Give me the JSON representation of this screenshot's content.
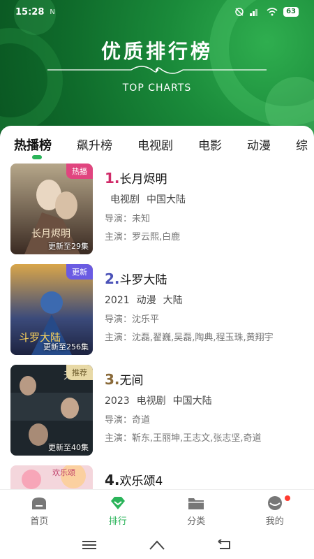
{
  "status": {
    "time": "15:28",
    "battery": "63",
    "nfc": "N"
  },
  "hero": {
    "title": "优质排行榜",
    "subtitle": "TOP CHARTS"
  },
  "tabs": [
    "热播榜",
    "飙升榜",
    "电视剧",
    "电影",
    "动漫",
    "综"
  ],
  "items": [
    {
      "rank": "1.",
      "rank_color": "#d02a68",
      "title": "长月烬明",
      "meta": [
        "电视剧",
        "中国大陆"
      ],
      "year": "",
      "director_label": "导演：",
      "director": "未知",
      "cast_label": "主演：",
      "cast": "罗云熙,白鹿",
      "badge": "热播",
      "badge_color": "#e0457f",
      "update": "更新至29集"
    },
    {
      "rank": "2.",
      "rank_color": "#4b52b8",
      "title": "斗罗大陆",
      "meta": [
        "动漫",
        "大陆"
      ],
      "year": "2021",
      "director_label": "导演：",
      "director": "沈乐平",
      "cast_label": "主演：",
      "cast": "沈磊,翟巍,吴磊,陶典,程玉珠,黄翔宇",
      "badge": "更新",
      "badge_color": "#6a5be2",
      "update": "更新至256集"
    },
    {
      "rank": "3.",
      "rank_color": "#8a6a3a",
      "title": "无间",
      "meta": [
        "电视剧",
        "中国大陆"
      ],
      "year": "2023",
      "director_label": "导演：",
      "director": "奇道",
      "cast_label": "主演：",
      "cast": "靳东,王丽坤,王志文,张志坚,奇道",
      "badge": "推荐",
      "badge_color": "#e8d9a6",
      "update": "更新至40集"
    },
    {
      "rank": "4.",
      "rank_color": "#222222",
      "title": "欢乐颂4",
      "meta": [],
      "year": "",
      "director_label": "",
      "director": "",
      "cast_label": "",
      "cast": "",
      "badge": "",
      "badge_color": "#ffffff",
      "update": ""
    }
  ],
  "nav": [
    {
      "label": "首页",
      "icon": "home-icon"
    },
    {
      "label": "排行",
      "icon": "ranking-icon"
    },
    {
      "label": "分类",
      "icon": "folder-icon"
    },
    {
      "label": "我的",
      "icon": "profile-icon"
    }
  ],
  "colors": {
    "accent": "#2bb45a",
    "header": "#0f6b2b"
  }
}
